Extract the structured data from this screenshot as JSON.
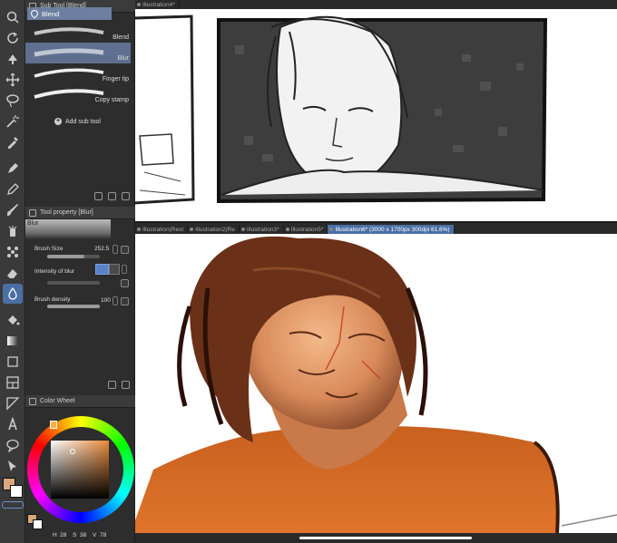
{
  "sub_tool": {
    "header_title": "Sub Tool [Blend]",
    "items": [
      {
        "label": "Blend"
      },
      {
        "label": "Blur"
      },
      {
        "label": "Finger tip"
      },
      {
        "label": "Copy stamp"
      }
    ],
    "add_label": "Add sub tool"
  },
  "tool_property": {
    "header_title": "Tool property [Blur]",
    "preview_label": "Blur",
    "brush_size_label": "Brush Size",
    "brush_size_value": "252.5",
    "intensity_label": "Intensity of blur",
    "density_label": "Brush density",
    "density_value": "100",
    "brush_size_fraction": 0.7,
    "density_fraction": 1.0
  },
  "color_wheel": {
    "header_title": "Color Wheel",
    "h": "28",
    "s": "38",
    "v": "78",
    "main_color": "#d9a87c",
    "sub_color": "#ffffff"
  },
  "top_tabs": [
    {
      "label": "Illustration4*"
    }
  ],
  "bottom_tabs": [
    {
      "label": "Illustration(Rest"
    },
    {
      "label": "Illustration2(Re"
    },
    {
      "label": "Illustration3*"
    },
    {
      "label": "Illustration5*"
    },
    {
      "label": "Illustration6* (3000 x 1700px 300dpi 61.6%)"
    }
  ],
  "accent_color": "#4a6fa5",
  "toolbar_icons": [
    "zoom-icon",
    "rotate-icon",
    "move-layer-icon",
    "move-icon",
    "lasso-select-icon",
    "magic-wand-icon",
    "eyedropper-icon",
    "pen-icon",
    "pencil-icon",
    "brush-icon",
    "airbrush-icon",
    "decoration-icon",
    "eraser-icon",
    "blend-icon",
    "fill-icon",
    "gradient-icon",
    "figure-icon",
    "frame-icon",
    "ruler-icon",
    "text-icon",
    "balloon-icon",
    "correct-line-icon"
  ]
}
